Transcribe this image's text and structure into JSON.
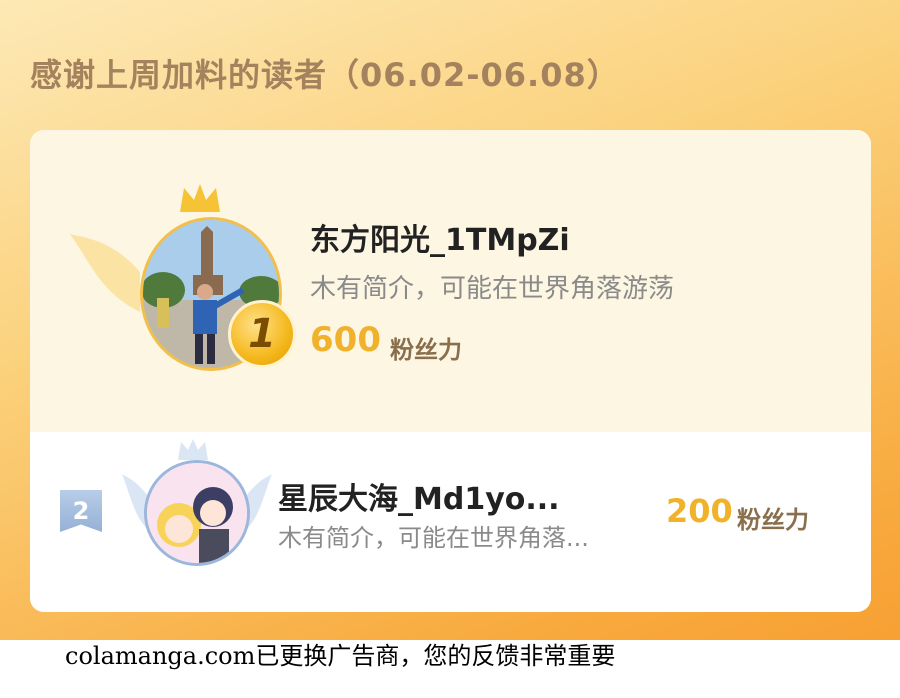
{
  "header": {
    "title": "感谢上周加料的读者（06.02-06.08）"
  },
  "leaders": [
    {
      "rank": "1",
      "name": "东方阳光_1TMpZi",
      "bio": "木有简介，可能在世界角落游荡",
      "fans_value": "600",
      "fans_unit": "粉丝力",
      "accent_color": "#f0b22a"
    },
    {
      "rank": "2",
      "name": "星辰大海_Md1yo...",
      "bio": "木有简介，可能在世界角落...",
      "fans_value": "200",
      "fans_unit": "粉丝力",
      "accent_color": "#9cb7dc"
    }
  ],
  "footer": {
    "notice": "colamanga.com已更换广告商，您的反馈非常重要"
  }
}
